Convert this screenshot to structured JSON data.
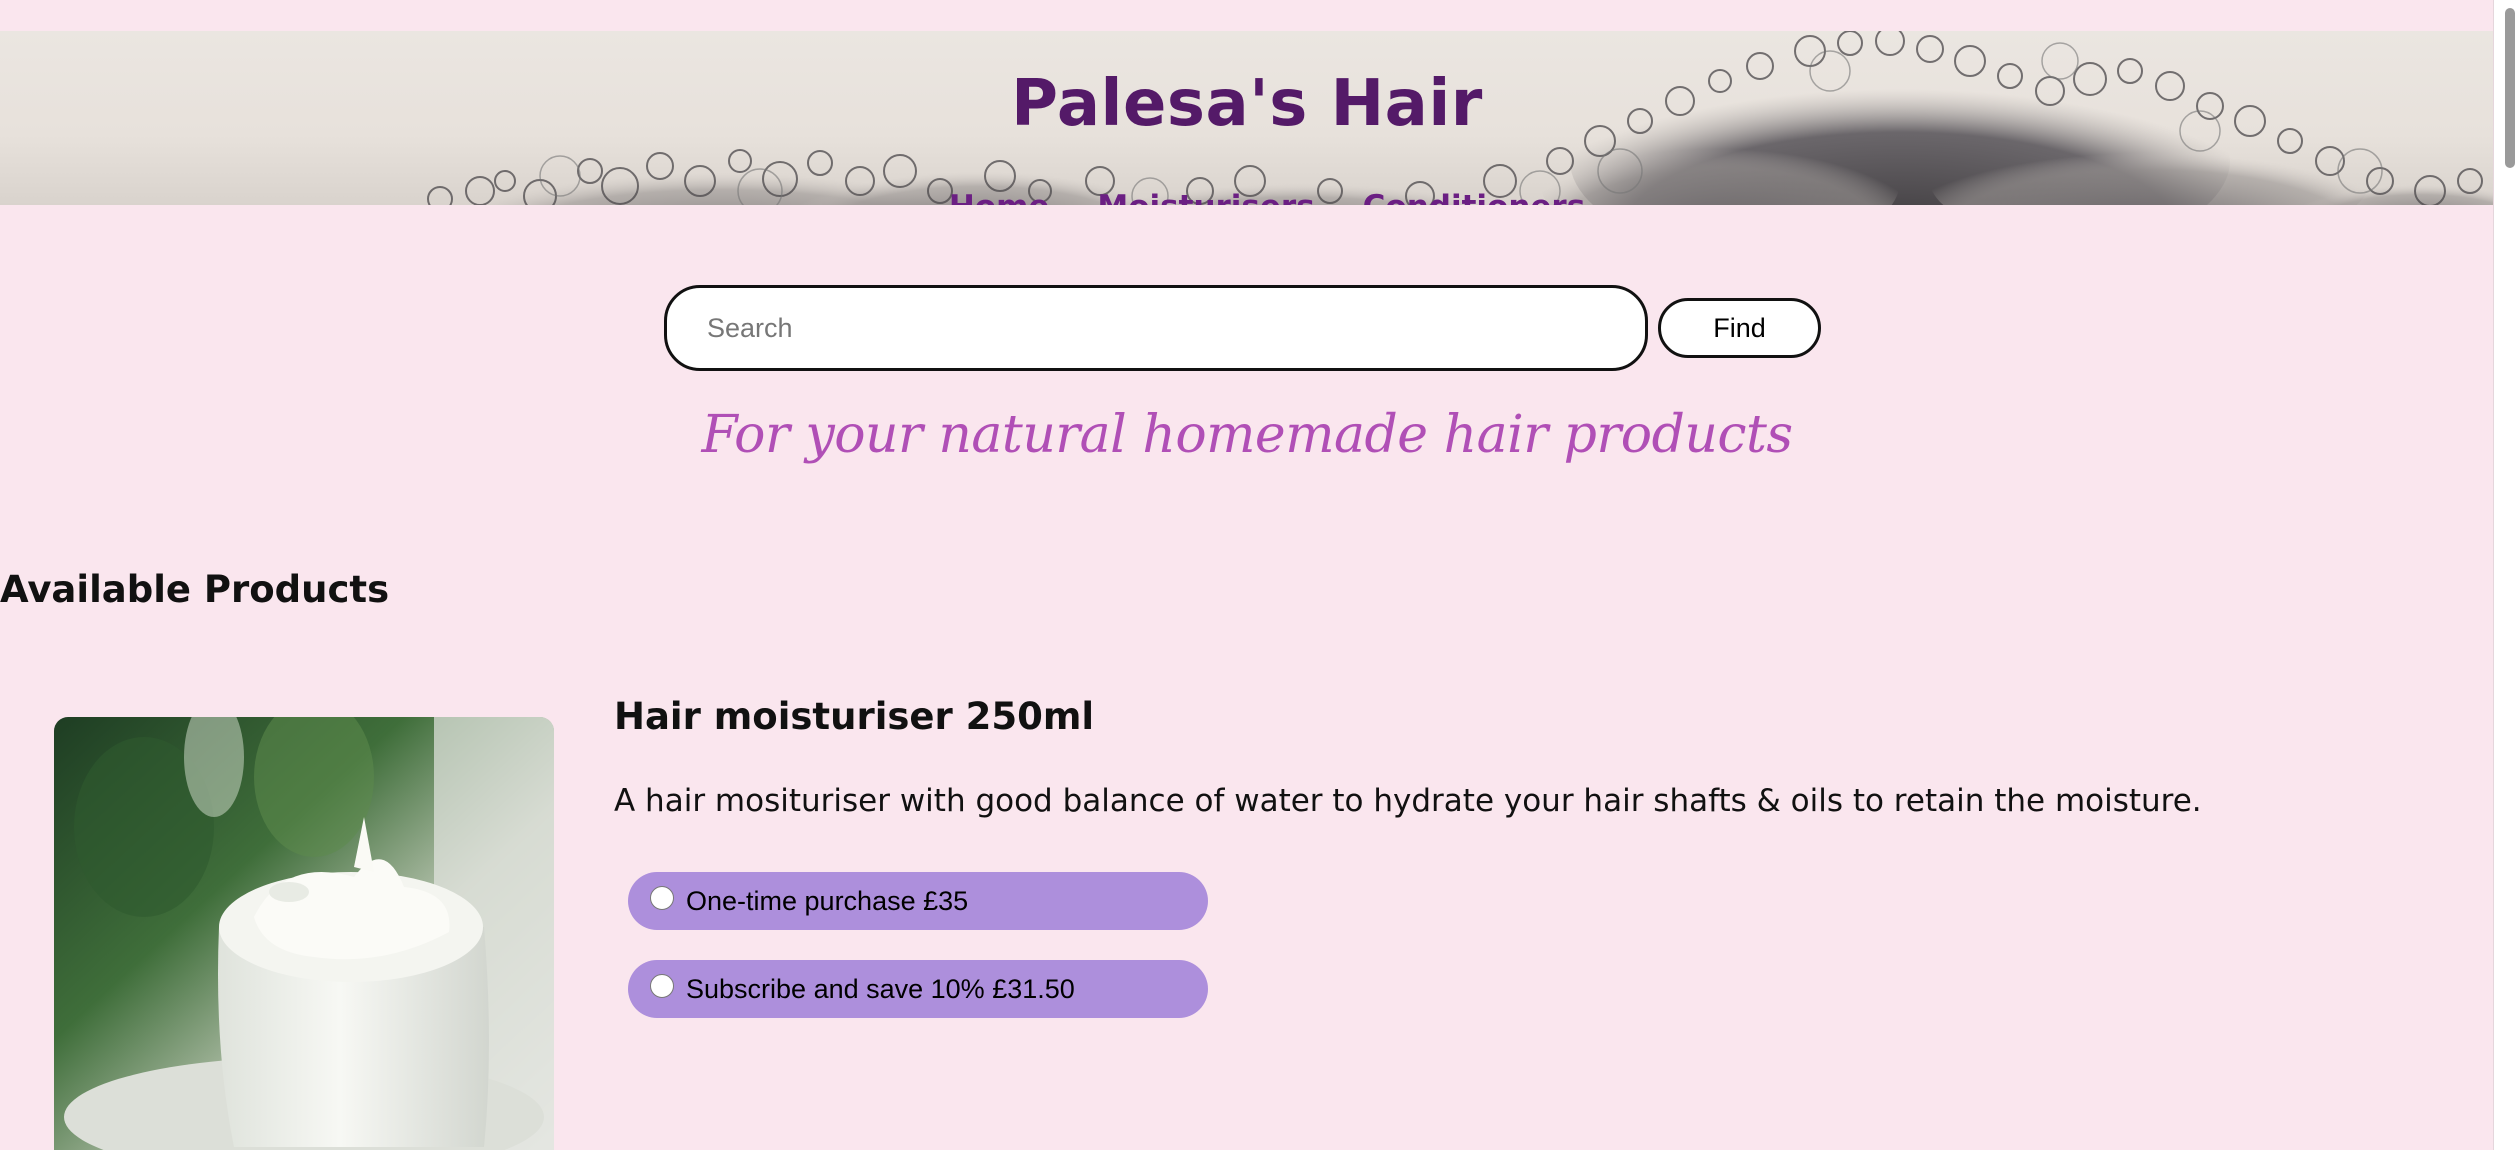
{
  "header": {
    "title": "Palesa's Hair",
    "nav": [
      {
        "label": "Home"
      },
      {
        "label": "Moisturisers"
      },
      {
        "label": "Conditioners"
      }
    ]
  },
  "search": {
    "placeholder": "Search",
    "value": "",
    "button_label": "Find"
  },
  "tagline": "For your natural homemade hair products",
  "products_section": {
    "heading": "Available Products",
    "items": [
      {
        "title": "Hair moisturiser 250ml",
        "description": "A hair mosituriser with good balance of water to hydrate your hair shafts & oils to retain the moisture.",
        "image_icon": "cream-jar-image",
        "options": [
          {
            "label": "One-time purchase £35",
            "selected": false
          },
          {
            "label": "Subscribe and save 10% £31.50",
            "selected": false
          }
        ]
      }
    ]
  },
  "colors": {
    "page_background": "#fae6ee",
    "title": "#541a68",
    "nav_link": "#6b1f83",
    "tagline": "#b04fb6",
    "option_pill": "#ad8fdc"
  }
}
